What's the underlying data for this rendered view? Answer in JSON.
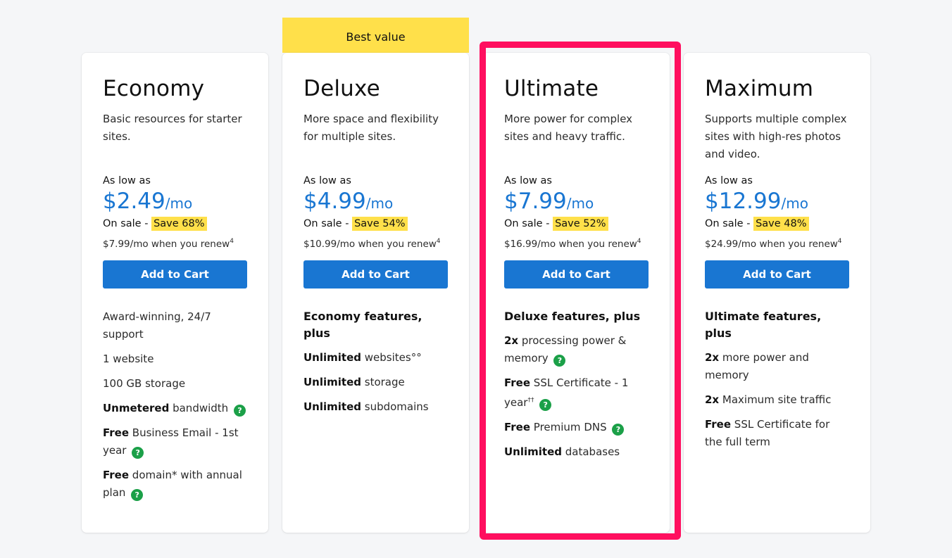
{
  "ribbon": {
    "label": "Best value"
  },
  "common": {
    "as_low_label": "As low as",
    "per_label": "/mo",
    "on_sale_label": "On sale - ",
    "cart_label": "Add to Cart",
    "renew_sup": "4",
    "help_glyph": "?"
  },
  "colors": {
    "accent": "#1976d2",
    "sale_highlight": "#ffe04a",
    "selection_border": "#ff0f5f",
    "help_icon": "#1ba048"
  },
  "plans": [
    {
      "name": "Economy",
      "description": "Basic resources for starter sites.",
      "price": "$2.49",
      "save": "Save 68%",
      "renew": "$7.99/mo when you renew",
      "features": [
        {
          "text": "Award-winning, 24/7 support"
        },
        {
          "text": "1 website"
        },
        {
          "text": "100 GB storage"
        },
        {
          "bold": "Unmetered",
          "text": " bandwidth",
          "help": true
        },
        {
          "bold": "Free",
          "text": " Business Email - 1st year",
          "help": true
        },
        {
          "bold": "Free",
          "text": " domain* with annual plan",
          "help": true
        }
      ]
    },
    {
      "name": "Deluxe",
      "description": "More space and flexibility for multiple sites.",
      "price": "$4.99",
      "save": "Save 54%",
      "renew": "$10.99/mo when you renew",
      "features_heading": "Economy features, plus",
      "features": [
        {
          "bold": "Unlimited",
          "text": " websites°°"
        },
        {
          "bold": "Unlimited",
          "text": " storage"
        },
        {
          "bold": "Unlimited",
          "text": " subdomains"
        }
      ]
    },
    {
      "name": "Ultimate",
      "description": "More power for complex sites and heavy traffic.",
      "price": "$7.99",
      "save": "Save 52%",
      "renew": "$16.99/mo when you renew",
      "features_heading": "Deluxe features, plus",
      "features": [
        {
          "bold": "2x",
          "text": " processing power & memory",
          "help": true
        },
        {
          "bold": "Free",
          "text": " SSL Certificate - 1 year",
          "sup": "††",
          "help": true
        },
        {
          "bold": "Free",
          "text": " Premium DNS",
          "help": true
        },
        {
          "bold": "Unlimited",
          "text": " databases"
        }
      ]
    },
    {
      "name": "Maximum",
      "description": "Supports multiple complex sites with high-res photos and video.",
      "price": "$12.99",
      "save": "Save 48%",
      "renew": "$24.99/mo when you renew",
      "features_heading": "Ultimate features, plus",
      "features": [
        {
          "bold": "2x",
          "text": " more power and memory"
        },
        {
          "bold": "2x",
          "text": " Maximum site traffic"
        },
        {
          "bold": "Free",
          "text": " SSL Certificate for the full term"
        }
      ]
    }
  ]
}
